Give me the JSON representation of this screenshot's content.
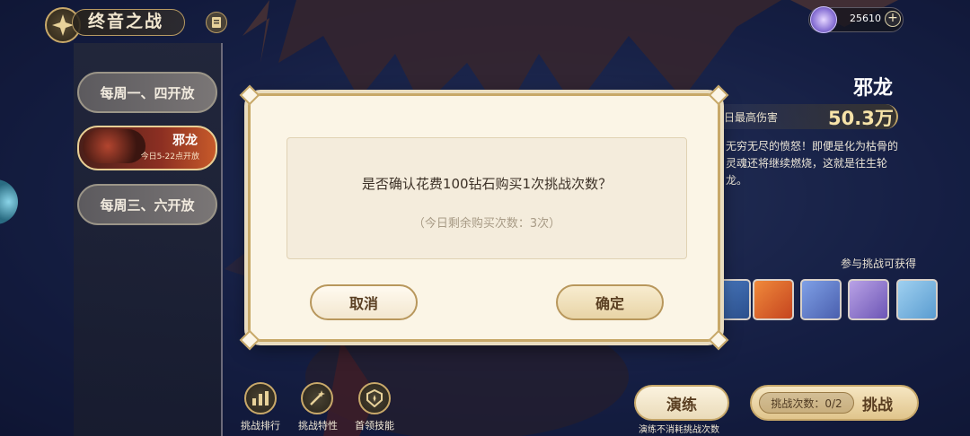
{
  "header": {
    "title": "终音之战",
    "emblem_icon": "compass-emblem-icon",
    "menu_icon": "scroll-menu-icon"
  },
  "currency": {
    "icon": "diamond-gem-icon",
    "amount": "25610",
    "add_symbol": "+"
  },
  "boss_list": [
    {
      "label": "每周一、四开放",
      "active": false
    },
    {
      "name": "邪龙",
      "sub": "今日5-22点开放",
      "active": true
    },
    {
      "label": "每周三、六开放",
      "active": false
    }
  ],
  "boss_info": {
    "name": "邪龙",
    "damage_label": "日最高伤害",
    "damage_value": "50.3万",
    "description": "无穷无尽的愤怒！即便是化为枯骨的灵魂还将继续燃烧，这就是往生轮龙。"
  },
  "rewards": {
    "label": "参与挑战可获得",
    "items": [
      "card-icon",
      "food-basket-icon",
      "blue-card-icon",
      "crystal-ore-icon",
      "hourglass-icon"
    ]
  },
  "bottom_bar": {
    "buttons": [
      {
        "label": "挑战排行",
        "icon": "ranking-bars-icon"
      },
      {
        "label": "挑战特性",
        "icon": "magic-wand-icon"
      },
      {
        "label": "首领技能",
        "icon": "skill-crest-icon"
      }
    ],
    "practice_label": "演练",
    "practice_sub": "演练不消耗挑战次数",
    "challenge_count": "挑战次数：0/2",
    "challenge_label": "挑战"
  },
  "dialog": {
    "message": "是否确认花费100钻石购买1次挑战次数？",
    "sub": "（今日剩余购买次数：3次）",
    "cancel_label": "取消",
    "confirm_label": "确定"
  }
}
